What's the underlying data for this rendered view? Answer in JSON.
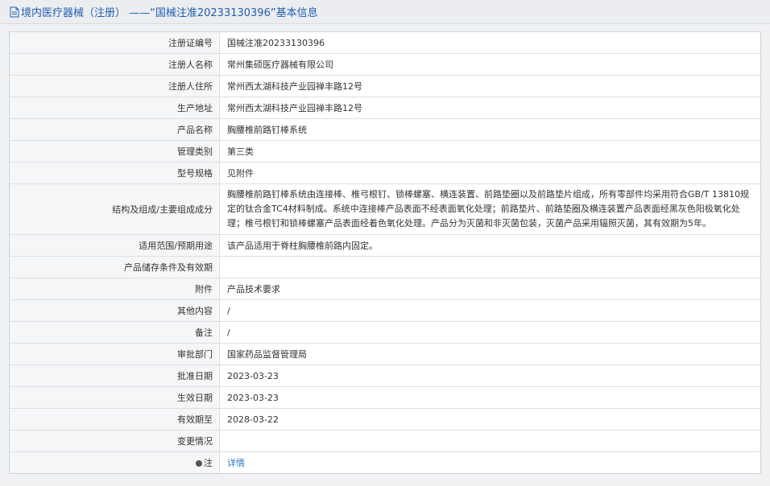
{
  "header": {
    "title": "境内医疗器械（注册） ——“国械注准20233130396”基本信息"
  },
  "rows": [
    {
      "label": "注册证编号",
      "value": "国械注准20233130396"
    },
    {
      "label": "注册人名称",
      "value": "常州集硕医疗器械有限公司"
    },
    {
      "label": "注册人住所",
      "value": "常州西太湖科技产业园禅丰路12号"
    },
    {
      "label": "生产地址",
      "value": "常州西太湖科技产业园禅丰路12号"
    },
    {
      "label": "产品名称",
      "value": "胸腰椎前路钉棒系统"
    },
    {
      "label": "管理类别",
      "value": "第三类"
    },
    {
      "label": "型号规格",
      "value": "见附件"
    },
    {
      "label": "结构及组成/主要组成成分",
      "value": "胸腰椎前路钉棒系统由连接棒、椎弓根钉、锁棒螺塞、横连装置、前路垫圈以及前路垫片组成，所有零部件均采用符合GB/T 13810规定的钛合金TC4材料制成。系统中连接棒产品表面不经表面氧化处理；前路垫片、前路垫圈及横连装置产品表面经黑灰色阳极氧化处理；椎弓根钉和锁棒螺塞产品表面经着色氧化处理。产品分为灭菌和非灭菌包装，灭菌产品采用辐照灭菌，其有效期为5年。"
    },
    {
      "label": "适用范围/预期用途",
      "value": "该产品适用于脊柱胸腰椎前路内固定。"
    },
    {
      "label": "产品储存条件及有效期",
      "value": ""
    },
    {
      "label": "附件",
      "value": "产品技术要求"
    },
    {
      "label": "其他内容",
      "value": "/"
    },
    {
      "label": "备注",
      "value": "/"
    },
    {
      "label": "审批部门",
      "value": "国家药品监督管理局"
    },
    {
      "label": "批准日期",
      "value": "2023-03-23"
    },
    {
      "label": "生效日期",
      "value": "2023-03-23"
    },
    {
      "label": "有效期至",
      "value": "2028-03-22"
    },
    {
      "label": "变更情况",
      "value": ""
    },
    {
      "label": "注",
      "value": "详情"
    }
  ]
}
